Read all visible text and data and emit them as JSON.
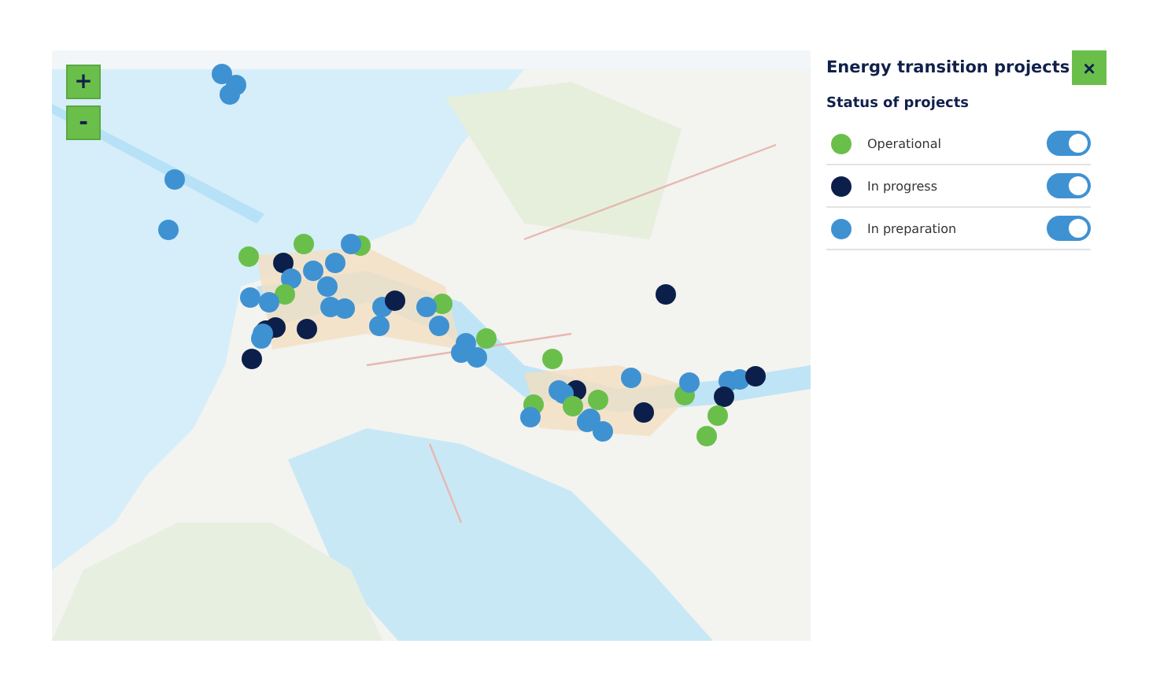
{
  "map": {
    "kind": "picture",
    "zoom_controls": [
      {
        "label": "+"
      },
      {
        "label": "-"
      }
    ]
  },
  "panel": {
    "title": "Energy transition projects",
    "close": "×",
    "section_title": "Status of projects",
    "statuses": [
      {
        "label": "Operational",
        "color": "#6abf4b",
        "on": true
      },
      {
        "label": "In progress",
        "color": "#0c1f4a",
        "on": true
      },
      {
        "label": "In preparation",
        "color": "#3f92d2",
        "on": true
      }
    ]
  }
}
